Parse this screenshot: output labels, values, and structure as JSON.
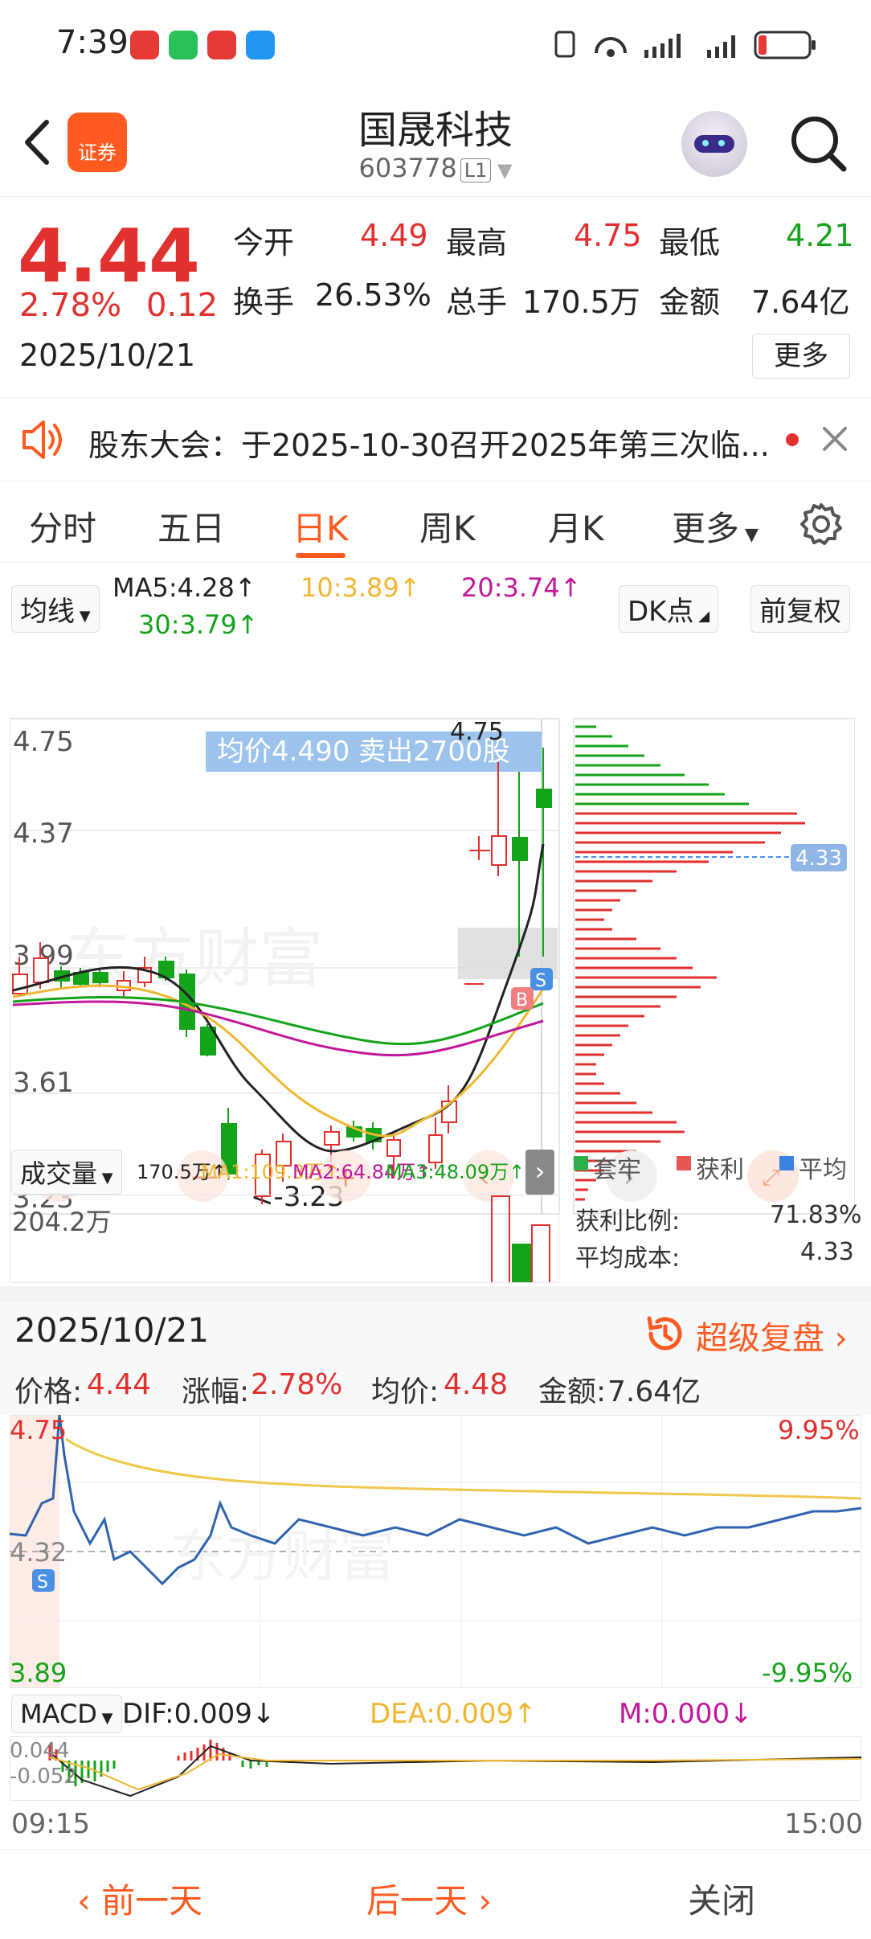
{
  "status": {
    "time": "7:39"
  },
  "header": {
    "title": "国晟科技",
    "code": "603778",
    "level": "L1",
    "logo_text": "证券"
  },
  "quote": {
    "price": "4.44",
    "change_pct": "2.78%",
    "change": "0.12",
    "date": "2025/10/21",
    "open_label": "今开",
    "open": "4.49",
    "high_label": "最高",
    "high": "4.75",
    "low_label": "最低",
    "low": "4.21",
    "turnover_label": "换手",
    "turnover": "26.53%",
    "volume_label": "总手",
    "volume": "170.5万",
    "amount_label": "金额",
    "amount": "7.64亿",
    "more_label": "更多"
  },
  "notice": {
    "text": "股东大会：于2025-10-30召开2025年第三次临..."
  },
  "tabs": [
    {
      "label": "分时"
    },
    {
      "label": "五日"
    },
    {
      "label": "日K"
    },
    {
      "label": "周K"
    },
    {
      "label": "月K"
    },
    {
      "label": "更多"
    }
  ],
  "ma_row": {
    "ma_select": "均线",
    "ma5": "MA5:4.28↑",
    "ma10": "10:3.89↑",
    "ma20": "20:3.74↑",
    "ma30": "30:3.79↑",
    "dk": "DK点",
    "adjust": "前复权"
  },
  "kchart": {
    "y_labels": [
      "4.75",
      "4.37",
      "3.99",
      "3.61",
      "3.23"
    ],
    "tooltip": "均价4.490  卖出2700股",
    "high_mark": "4.75",
    "low_mark": "<-3.23",
    "watermark": "东方财富",
    "cost_label": "4.33",
    "marker_s": "S",
    "marker_b": "B"
  },
  "volume": {
    "select": "成交量",
    "vol": "170.5万↑",
    "ma1": "MA1:109.3万↑",
    "ma2": "MA2:64.84万↑",
    "ma3": "MA3:48.09万↑",
    "max": "204.2万"
  },
  "chips": {
    "legend_trapped": "套牢",
    "legend_profit": "获利",
    "legend_avg": "平均",
    "ratio_label": "获利比例:",
    "ratio": "71.83%",
    "avg_label": "平均成本:",
    "avg": "4.33"
  },
  "detail": {
    "date": "2025/10/21",
    "replay": "超级复盘",
    "price_label": "价格:",
    "price": "4.44",
    "pct_label": "涨幅:",
    "pct": "2.78%",
    "avg_label": "均价:",
    "avg": "4.48",
    "amount_label": "金额:",
    "amount": "7.64亿"
  },
  "intraday": {
    "y_top": "4.75",
    "y_mid": "4.32",
    "y_bottom": "3.89",
    "pct_top": "9.95%",
    "pct_bottom": "-9.95%",
    "marker_s": "S",
    "watermark": "东方财富"
  },
  "macd": {
    "select": "MACD",
    "dif": "DIF:0.009↓",
    "dea": "DEA:0.009↑",
    "m": "M:0.000↓",
    "top": "0.044",
    "bottom": "-0.052",
    "t_start": "09:15",
    "t_end": "15:00"
  },
  "bottom": {
    "prev": "前一天",
    "next": "后一天",
    "close": "关闭"
  },
  "colors": {
    "up": "#e0312f",
    "down": "#14a31b",
    "accent": "#ff5a1f",
    "ma5": "#222222",
    "ma10": "#f0b630",
    "ma20": "#c2189a",
    "ma30": "#14a31b"
  }
}
